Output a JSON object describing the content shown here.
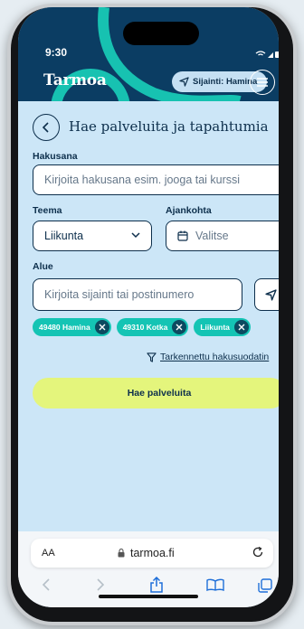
{
  "status": {
    "time": "9:30"
  },
  "header": {
    "logo": "Tarmoa",
    "location_label": "Sijainti: Hamina",
    "menu_icon": "hamburger-menu-icon"
  },
  "page": {
    "title": "Hae palveluita ja tapahtumia"
  },
  "form": {
    "search": {
      "label": "Hakusana",
      "placeholder": "Kirjoita hakusana esim. jooga tai kurssi"
    },
    "theme": {
      "label": "Teema",
      "value": "Liikunta"
    },
    "date": {
      "label": "Ajankohta",
      "placeholder": "Valitse"
    },
    "area": {
      "label": "Alue",
      "placeholder": "Kirjoita sijainti tai postinumero"
    },
    "tags": [
      {
        "label": "49480 Hamina"
      },
      {
        "label": "49310 Kotka"
      },
      {
        "label": "Liikunta"
      }
    ],
    "advanced_label": "Tarkennettu hakusuodatin",
    "submit_label": "Hae palveluita"
  },
  "browser": {
    "text_size": "AA",
    "url": "tarmoa.fi"
  },
  "colors": {
    "header_bg": "#0b3d63",
    "page_bg": "#cce6f7",
    "tag_bg": "#14c4b4",
    "button_bg": "#e4f57c",
    "text_dark": "#0d2f4c"
  }
}
